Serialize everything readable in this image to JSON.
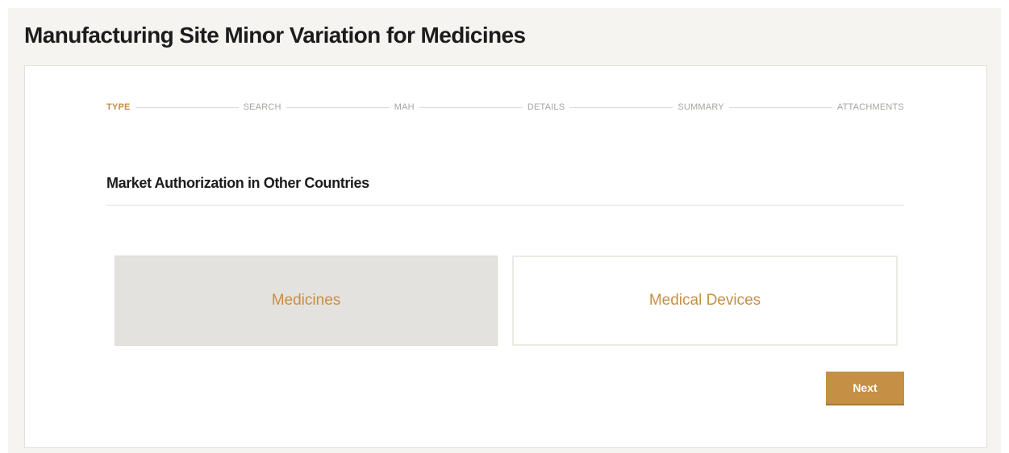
{
  "page": {
    "title": "Manufacturing Site Minor Variation for Medicines"
  },
  "stepper": {
    "steps": [
      {
        "label": "TYPE",
        "active": true
      },
      {
        "label": "SEARCH",
        "active": false
      },
      {
        "label": "MAH",
        "active": false
      },
      {
        "label": "DETAILS",
        "active": false
      },
      {
        "label": "SUMMARY",
        "active": false
      },
      {
        "label": "ATTACHMENTS",
        "active": false
      }
    ]
  },
  "section": {
    "title": "Market Authorization in Other Countries"
  },
  "options": {
    "medicines": {
      "label": "Medicines",
      "selected": true
    },
    "medical_devices": {
      "label": "Medical Devices",
      "selected": false
    }
  },
  "actions": {
    "next_label": "Next"
  },
  "colors": {
    "accent": "#c58f45",
    "selected_bg": "#e4e2de",
    "page_bg": "#f5f4f1"
  }
}
